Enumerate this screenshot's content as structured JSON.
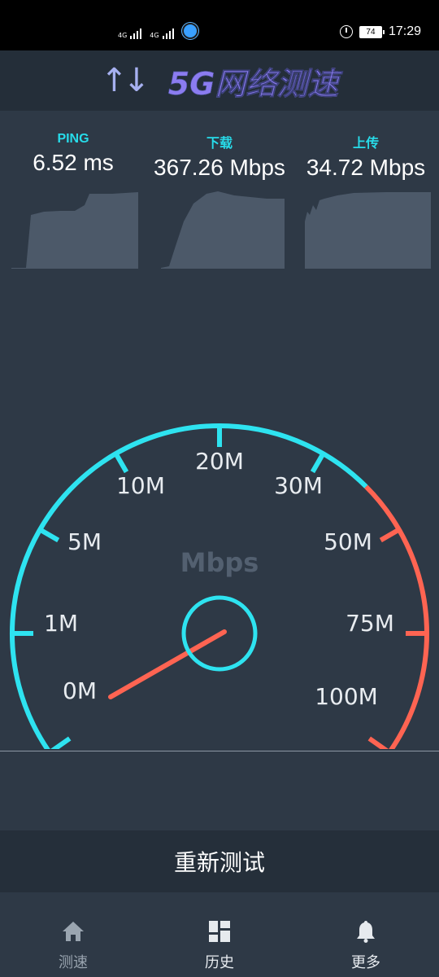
{
  "status_bar": {
    "signal1_label": "4G",
    "signal2_label": "4G",
    "battery": "74",
    "time": "17:29"
  },
  "header": {
    "title": "5G网络测速",
    "arrows": "↑↓"
  },
  "stats": {
    "ping": {
      "label": "PING",
      "value": "6.52 ms"
    },
    "download": {
      "label": "下载",
      "value": "367.26 Mbps"
    },
    "upload": {
      "label": "上传",
      "value": "34.72 Mbps"
    }
  },
  "gauge": {
    "unit": "Mbps",
    "ticks": [
      "0M",
      "1M",
      "5M",
      "10M",
      "20M",
      "30M",
      "50M",
      "75M",
      "100M"
    ],
    "needle_value_label": "≈0M"
  },
  "actions": {
    "retest_label": "重新测试"
  },
  "tabs": [
    {
      "label": "测速",
      "icon": "home-icon",
      "active": true
    },
    {
      "label": "历史",
      "icon": "grid-icon",
      "active": false
    },
    {
      "label": "更多",
      "icon": "bell-icon",
      "active": false
    }
  ],
  "colors": {
    "accent_cyan": "#2ee3f0",
    "accent_red": "#ff6452",
    "background": "#2e3946",
    "header_bg": "#242e39",
    "sparkline_fill": "#4a5767"
  }
}
